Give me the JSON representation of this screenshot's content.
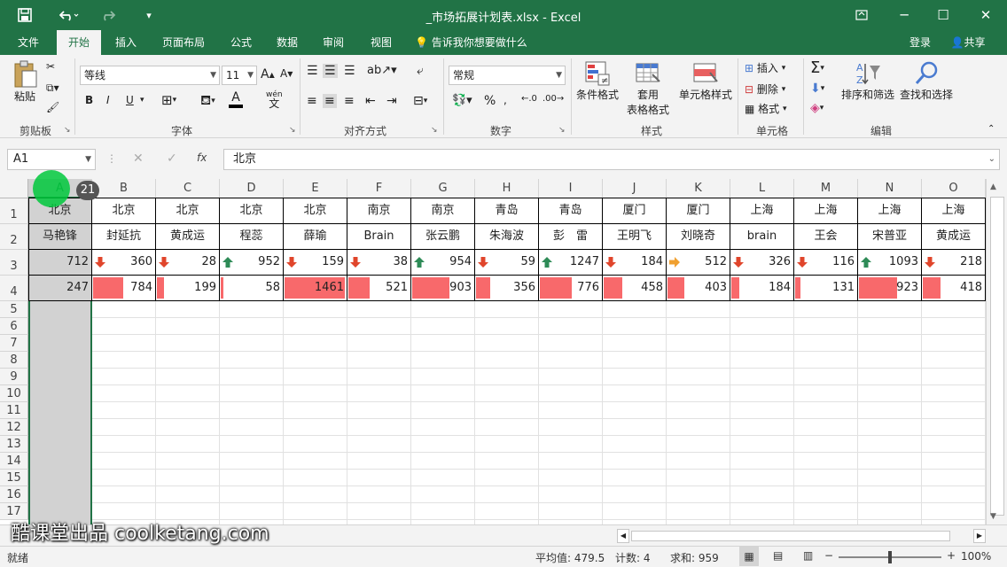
{
  "window": {
    "title": "_市场拓展计划表.xlsx - Excel",
    "save_icon": "save-icon",
    "undo_icon": "undo-icon",
    "redo_icon": "redo-icon"
  },
  "tabs": [
    {
      "label": "文件"
    },
    {
      "label": "开始"
    },
    {
      "label": "插入"
    },
    {
      "label": "页面布局"
    },
    {
      "label": "公式"
    },
    {
      "label": "数据"
    },
    {
      "label": "审阅"
    },
    {
      "label": "视图"
    }
  ],
  "tell_me": "告诉我你想要做什么",
  "login": "登录",
  "share": "共享",
  "ribbon": {
    "clipboard": {
      "paste": "粘贴",
      "label": "剪贴板"
    },
    "font": {
      "name": "等线",
      "size": "11",
      "label": "字体",
      "bold": "B",
      "italic": "I",
      "underline": "U",
      "wen": "wén",
      "wen2": "文"
    },
    "alignment": {
      "label": "对齐方式"
    },
    "number": {
      "format": "常规",
      "label": "数字",
      "percent": "%"
    },
    "styles": {
      "conditional": "条件格式",
      "table1": "套用",
      "table2": "表格格式",
      "cell": "单元格样式",
      "label": "样式"
    },
    "cells": {
      "insert": "插入",
      "delete": "删除",
      "format": "格式",
      "label": "单元格"
    },
    "editing": {
      "sort": "排序和筛选",
      "find": "查找和选择",
      "label": "编辑"
    }
  },
  "formula_bar": {
    "cell_ref": "A1",
    "fx": "fx",
    "value": "北京"
  },
  "columns": [
    "A",
    "B",
    "C",
    "D",
    "E",
    "F",
    "G",
    "H",
    "I",
    "J",
    "K",
    "L",
    "M",
    "N",
    "O"
  ],
  "rows": [
    "1",
    "2",
    "3",
    "4",
    "5",
    "6",
    "7",
    "8",
    "9",
    "10",
    "11",
    "12",
    "13",
    "14",
    "15",
    "16",
    "17"
  ],
  "table": {
    "row1": [
      "北京",
      "北京",
      "北京",
      "北京",
      "北京",
      "南京",
      "南京",
      "青岛",
      "青岛",
      "厦门",
      "厦门",
      "上海",
      "上海",
      "上海",
      "上海"
    ],
    "row2": [
      "马艳锋",
      "封延抗",
      "黄成运",
      "程蕊",
      "薛瑜",
      "Brain",
      "张云鹏",
      "朱海波",
      "彭　雷",
      "王明飞",
      "刘晓奇",
      "brain",
      "王会",
      "宋普亚",
      "黄成运"
    ],
    "row3": [
      {
        "value": "712",
        "arrow": ""
      },
      {
        "value": "360",
        "arrow": "down"
      },
      {
        "value": "28",
        "arrow": "down"
      },
      {
        "value": "952",
        "arrow": "up"
      },
      {
        "value": "159",
        "arrow": "down"
      },
      {
        "value": "38",
        "arrow": "down"
      },
      {
        "value": "954",
        "arrow": "up"
      },
      {
        "value": "59",
        "arrow": "down"
      },
      {
        "value": "1247",
        "arrow": "up"
      },
      {
        "value": "184",
        "arrow": "down"
      },
      {
        "value": "512",
        "arrow": "right"
      },
      {
        "value": "326",
        "arrow": "down"
      },
      {
        "value": "116",
        "arrow": "down"
      },
      {
        "value": "1093",
        "arrow": "up"
      },
      {
        "value": "218",
        "arrow": "down"
      }
    ],
    "row4": [
      {
        "value": "247",
        "bar": 0
      },
      {
        "value": "784",
        "bar": 0.5
      },
      {
        "value": "199",
        "bar": 0.12
      },
      {
        "value": "58",
        "bar": 0.04
      },
      {
        "value": "1461",
        "bar": 1.0
      },
      {
        "value": "521",
        "bar": 0.36
      },
      {
        "value": "903",
        "bar": 0.62
      },
      {
        "value": "356",
        "bar": 0.24
      },
      {
        "value": "776",
        "bar": 0.53
      },
      {
        "value": "458",
        "bar": 0.31
      },
      {
        "value": "403",
        "bar": 0.28
      },
      {
        "value": "184",
        "bar": 0.13
      },
      {
        "value": "131",
        "bar": 0.09
      },
      {
        "value": "923",
        "bar": 0.63
      },
      {
        "value": "418",
        "bar": 0.29
      }
    ]
  },
  "colors": {
    "brand": "#217346",
    "databar": "#f8696b",
    "arrow_up": "#2e8b57",
    "arrow_down": "#e0452b",
    "arrow_right": "#f0a030"
  },
  "cursor_badge": "21",
  "status": {
    "ready": "就绪",
    "average": "平均值: 479.5",
    "count": "计数: 4",
    "sum": "求和: 959",
    "zoom": "100%"
  },
  "watermark": "酷课堂出品 coolketang.com"
}
